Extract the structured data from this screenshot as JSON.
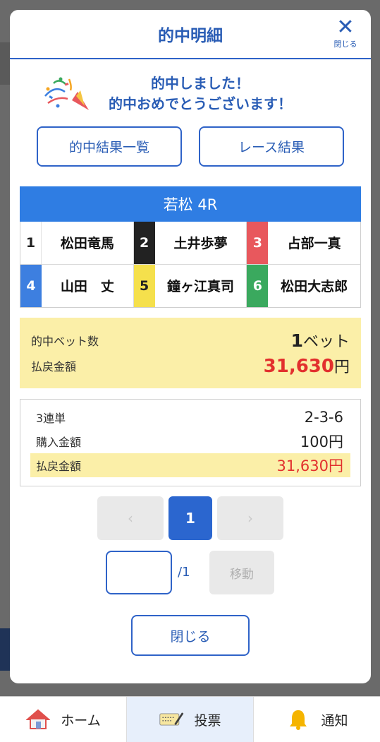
{
  "modal": {
    "title": "的中明細",
    "close_label": "閉じる",
    "congrats_line1": "的中しました！",
    "congrats_line2": "的中おめでとうございます！",
    "hit_list_button": "的中結果一覧",
    "race_result_button": "レース結果"
  },
  "race": {
    "title": "若松 4R",
    "racers": [
      {
        "num": "1",
        "name": "松田竜馬",
        "bg": "#ffffff",
        "fg": "#222222"
      },
      {
        "num": "2",
        "name": "土井歩夢",
        "bg": "#222222",
        "fg": "#ffffff"
      },
      {
        "num": "3",
        "name": "占部一真",
        "bg": "#e8585d",
        "fg": "#ffffff"
      },
      {
        "num": "4",
        "name": "山田　丈",
        "bg": "#3d7fe0",
        "fg": "#ffffff"
      },
      {
        "num": "5",
        "name": "鐘ヶ江真司",
        "bg": "#f5e04c",
        "fg": "#222222"
      },
      {
        "num": "6",
        "name": "松田大志郎",
        "bg": "#3aa95e",
        "fg": "#ffffff"
      }
    ]
  },
  "summary": {
    "bets_label": "的中ベット数",
    "bets_value": "1",
    "bets_unit": "ベット",
    "payout_label": "払戻金額",
    "payout_value": "31,630",
    "payout_unit": "円"
  },
  "detail": {
    "type_label": "3連単",
    "type_value": "2-3-6",
    "purchase_label": "購入金額",
    "purchase_value": "100円",
    "payout_label": "払戻金額",
    "payout_value": "31,630円"
  },
  "pager": {
    "prev": "‹",
    "current": "1",
    "next": "›",
    "total": "/1",
    "move_label": "移動"
  },
  "close_button": "閉じる",
  "nav": {
    "home": "ホーム",
    "vote": "投票",
    "notify": "通知"
  },
  "colors": {
    "accent": "#2f63c8",
    "race_header": "#2f7de3",
    "highlight": "#fbefa8",
    "payout_red": "#e2302e"
  }
}
